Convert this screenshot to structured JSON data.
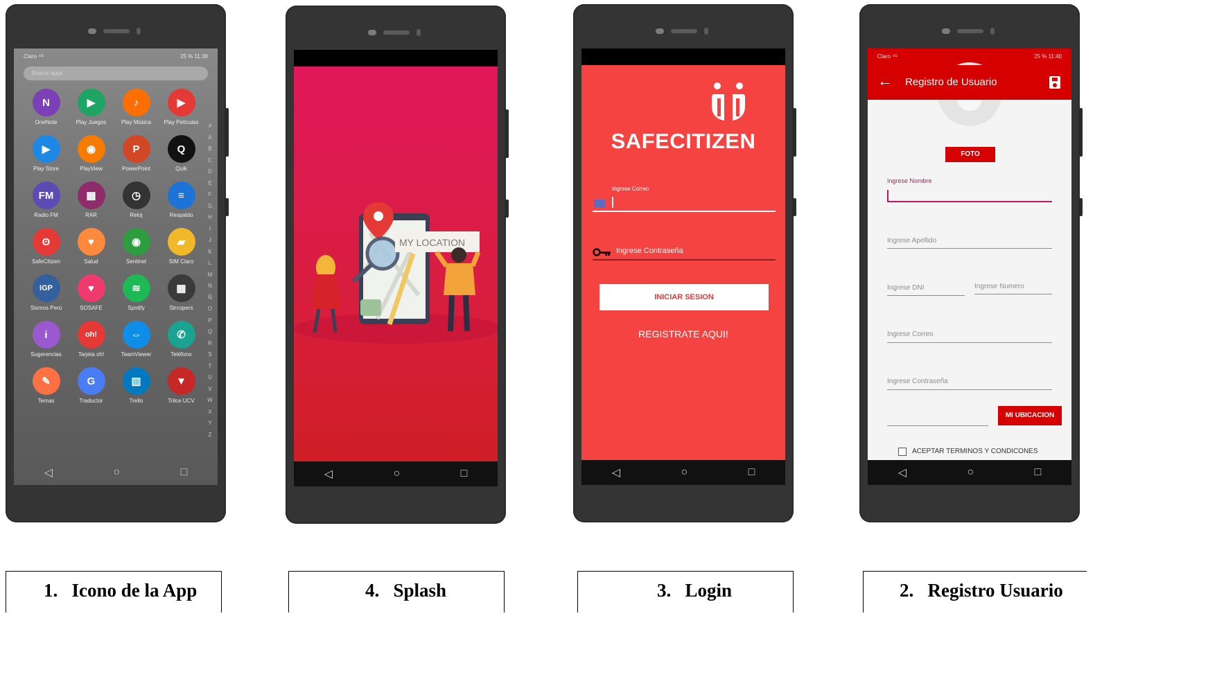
{
  "phone1": {
    "status_left": "Claro ⁴ᴳ ",
    "status_right": "25 %  11:38",
    "search_placeholder": "Buscar apps",
    "apps": [
      {
        "label": "OneNote",
        "icon": "onenote-icon",
        "glyph": "N",
        "bg": "#7b3fb7"
      },
      {
        "label": "Play Juegos",
        "icon": "play-games-icon",
        "glyph": "▶",
        "bg": "#1fa463"
      },
      {
        "label": "Play Música",
        "icon": "play-music-icon",
        "glyph": "♪",
        "bg": "#ff6f00"
      },
      {
        "label": "Play Películas",
        "icon": "play-movies-icon",
        "glyph": "▶",
        "bg": "#e53935"
      },
      {
        "label": "Play Store",
        "icon": "play-store-icon",
        "glyph": "▶",
        "bg": "#1e88e5"
      },
      {
        "label": "PlayView",
        "icon": "playview-icon",
        "glyph": "◉",
        "bg": "#f57c00"
      },
      {
        "label": "PowerPoint",
        "icon": "powerpoint-icon",
        "glyph": "P",
        "bg": "#d24726"
      },
      {
        "label": "Quik",
        "icon": "quik-icon",
        "glyph": "Q",
        "bg": "#111111"
      },
      {
        "label": "Radio FM",
        "icon": "radio-icon",
        "glyph": "FM",
        "bg": "#5c4bb5"
      },
      {
        "label": "RAR",
        "icon": "rar-icon",
        "glyph": "▦",
        "bg": "#8e2b6b"
      },
      {
        "label": "Reloj",
        "icon": "clock-icon",
        "glyph": "◷",
        "bg": "#333333"
      },
      {
        "label": "Respaldo",
        "icon": "backup-icon",
        "glyph": "≡",
        "bg": "#1e73d6"
      },
      {
        "label": "SafeCitizen",
        "icon": "safecitizen-icon",
        "glyph": "ʘ",
        "bg": "#e53935"
      },
      {
        "label": "Salud",
        "icon": "health-icon",
        "glyph": "♥",
        "bg": "#ff8a3d"
      },
      {
        "label": "Sentinel",
        "icon": "sentinel-icon",
        "glyph": "◉",
        "bg": "#2e9d3f"
      },
      {
        "label": "SIM Claro",
        "icon": "sim-icon",
        "glyph": "▰",
        "bg": "#f1b92a"
      },
      {
        "label": "Sismos Perú",
        "icon": "igp-icon",
        "glyph": "IGP",
        "bg": "#34609e"
      },
      {
        "label": "SOSAFE",
        "icon": "sosafe-icon",
        "glyph": "♥",
        "bg": "#ef3a6d"
      },
      {
        "label": "Spotify",
        "icon": "spotify-icon",
        "glyph": "≋",
        "bg": "#1db954"
      },
      {
        "label": "Strcopers",
        "icon": "strcopers-icon",
        "glyph": "▦",
        "bg": "#3a3a3a"
      },
      {
        "label": "Sugerencias",
        "icon": "tips-icon",
        "glyph": "i",
        "bg": "#9b59d0"
      },
      {
        "label": "Tarjeta oh!",
        "icon": "oh-card-icon",
        "glyph": "oh!",
        "bg": "#e53935"
      },
      {
        "label": "TeamViewer",
        "icon": "teamviewer-icon",
        "glyph": "⇔",
        "bg": "#0e8ee9"
      },
      {
        "label": "Teléfono",
        "icon": "phone-icon",
        "glyph": "✆",
        "bg": "#1aa390"
      },
      {
        "label": "Temas",
        "icon": "themes-icon",
        "glyph": "✎",
        "bg": "#ff7043"
      },
      {
        "label": "Traductor",
        "icon": "translate-icon",
        "glyph": "G",
        "bg": "#4a7cf3"
      },
      {
        "label": "Trello",
        "icon": "trello-icon",
        "glyph": "▥",
        "bg": "#0079bf"
      },
      {
        "label": "Trilce UCV",
        "icon": "trilce-icon",
        "glyph": "▼",
        "bg": "#c62828"
      }
    ],
    "alphabet": "#ABCDEFGHIJKLMNÑOPQRSTUVWXYZ"
  },
  "phone2": {
    "location_label": "MY LOCATION"
  },
  "phone3": {
    "brand": "SAFECITIZEN",
    "email_label": "Ingrese Correo",
    "password_label": "Ingrese Contraseña",
    "login_button": "INICIAR SESION",
    "register_link": "REGISTRATE AQUI!"
  },
  "phone4": {
    "status_left": "Claro ⁴ᴳ",
    "status_right": "25 %  11:40",
    "title": "Registro de Usuario",
    "photo_button": "FOTO",
    "name_label": "Ingrese Nombre",
    "lastname_label": "Ingrese Apellido",
    "dni_label": "Ingrese DNI",
    "number_label": "Ingrese Numero",
    "email_label": "Ingrese Correo",
    "password_label": "Ingrese Contraseña",
    "location_button": "MI UBICACION",
    "terms_label": "ACEPTAR TERMINOS Y CONDICONES"
  },
  "nav": {
    "back": "◁",
    "home": "○",
    "recent": "□"
  },
  "captions": [
    {
      "num": "1.",
      "text": "Icono de la App"
    },
    {
      "num": "4.",
      "text": "Splash"
    },
    {
      "num": "3.",
      "text": "Login"
    },
    {
      "num": "2.",
      "text": "Registro Usuario"
    }
  ],
  "colors": {
    "brand_red": "#f44340",
    "app_bar_red": "#d50000",
    "splash_top": "#e0175a"
  }
}
